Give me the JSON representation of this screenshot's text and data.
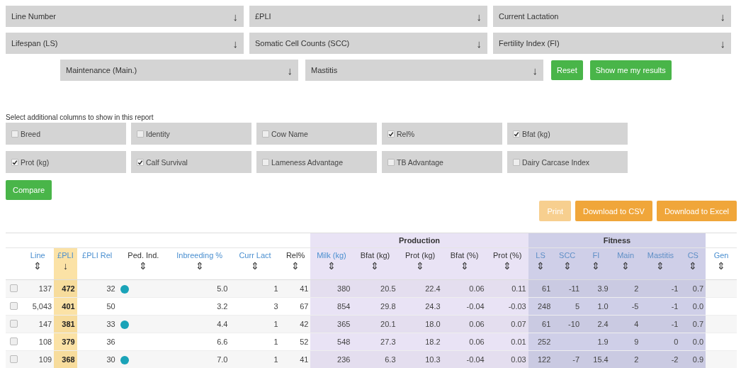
{
  "filters": [
    {
      "label": "Line Number",
      "arrow": "↓"
    },
    {
      "label": "£PLI",
      "arrow": "↓"
    },
    {
      "label": "Current Lactation",
      "arrow": "↓"
    },
    {
      "label": "Lifespan (LS)",
      "arrow": "↓"
    },
    {
      "label": "Somatic Cell Counts (SCC)",
      "arrow": "↓"
    },
    {
      "label": "Fertility Index (FI)",
      "arrow": "↓"
    },
    {
      "label": "Maintenance (Main.)",
      "arrow": "↓"
    },
    {
      "label": "Mastitis",
      "arrow": "↓"
    }
  ],
  "filter_buttons": [
    "Reset",
    "Show me my results"
  ],
  "columns_prompt": "Select additional columns to show in this report",
  "column_options": [
    {
      "label": "Breed",
      "checked": false
    },
    {
      "label": "Identity",
      "checked": false
    },
    {
      "label": "Cow Name",
      "checked": false
    },
    {
      "label": "Rel%",
      "checked": true
    },
    {
      "label": "Bfat (kg)",
      "checked": true
    },
    {
      "label": "Prot (kg)",
      "checked": true
    },
    {
      "label": "Calf Survival",
      "checked": true
    },
    {
      "label": "Lameness Advantage",
      "checked": false
    },
    {
      "label": "TB Advantage",
      "checked": false
    },
    {
      "label": "Dairy Carcase Index",
      "checked": false
    }
  ],
  "compare_button": "Compare",
  "export_buttons": [
    {
      "label": "Print",
      "disabled": true
    },
    {
      "label": "Download to CSV",
      "disabled": false
    },
    {
      "label": "Download to Excel",
      "disabled": false
    }
  ],
  "table": {
    "groups": [
      {
        "label": "Production",
        "kind": "production"
      },
      {
        "label": "Fitness",
        "kind": "fitness"
      }
    ],
    "columns": [
      {
        "label": "Line",
        "sort": "⇕",
        "link": true,
        "kind": "plain",
        "sorted": false
      },
      {
        "label": "£PLI",
        "sort": "↓",
        "link": true,
        "kind": "plain",
        "sorted": true
      },
      {
        "label": "£PLI Rel",
        "link": true,
        "kind": "plain",
        "sorted": false
      },
      {
        "label": "Ped. Ind.",
        "sort": "⇕",
        "link": false,
        "kind": "plain",
        "sorted": false
      },
      {
        "label": "Inbreeding %",
        "sort": "⇕",
        "link": true,
        "kind": "plain",
        "sorted": false
      },
      {
        "label": "Curr Lact",
        "sort": "⇕",
        "link": true,
        "kind": "plain",
        "sorted": false
      },
      {
        "label": "Rel%",
        "sort": "⇕",
        "link": false,
        "kind": "plain",
        "sorted": false
      },
      {
        "label": "Milk (kg)",
        "sort": "⇕",
        "link": true,
        "kind": "production",
        "sorted": false
      },
      {
        "label": "Bfat (kg)",
        "sort": "⇕",
        "link": false,
        "kind": "production",
        "sorted": false
      },
      {
        "label": "Prot (kg)",
        "sort": "⇕",
        "link": false,
        "kind": "production",
        "sorted": false
      },
      {
        "label": "Bfat (%)",
        "sort": "⇕",
        "link": false,
        "kind": "production",
        "sorted": false
      },
      {
        "label": "Prot (%)",
        "sort": "⇕",
        "link": false,
        "kind": "production",
        "sorted": false
      },
      {
        "label": "LS",
        "sort": "⇕",
        "link": true,
        "kind": "fitness",
        "sorted": false
      },
      {
        "label": "SCC",
        "sort": "⇕",
        "link": true,
        "kind": "fitness",
        "sorted": false
      },
      {
        "label": "FI",
        "sort": "⇕",
        "link": true,
        "kind": "fitness",
        "sorted": false
      },
      {
        "label": "Main",
        "sort": "⇕",
        "link": true,
        "kind": "fitness",
        "sorted": false
      },
      {
        "label": "Mastitis",
        "sort": "⇕",
        "link": true,
        "kind": "fitness",
        "sorted": false
      },
      {
        "label": "CS",
        "sort": "⇕",
        "link": true,
        "kind": "fitness",
        "sorted": false
      },
      {
        "label": "Gen",
        "sort": "⇕",
        "link": true,
        "kind": "plain",
        "sorted": false
      }
    ],
    "rows": [
      {
        "selected": false,
        "ped_badge": true,
        "cells": [
          "137",
          "472",
          "32",
          "",
          "5.0",
          "1",
          "41",
          "380",
          "20.5",
          "22.4",
          "0.06",
          "0.11",
          "61",
          "-11",
          "3.9",
          "2",
          "-1",
          "0.7",
          ""
        ]
      },
      {
        "selected": false,
        "ped_badge": false,
        "cells": [
          "5,043",
          "401",
          "50",
          "",
          "3.2",
          "3",
          "67",
          "854",
          "29.8",
          "24.3",
          "-0.04",
          "-0.03",
          "248",
          "5",
          "1.0",
          "-5",
          "-1",
          "0.0",
          ""
        ]
      },
      {
        "selected": false,
        "ped_badge": true,
        "cells": [
          "147",
          "381",
          "33",
          "",
          "4.4",
          "1",
          "42",
          "365",
          "20.1",
          "18.0",
          "0.06",
          "0.07",
          "61",
          "-10",
          "2.4",
          "4",
          "-1",
          "0.7",
          ""
        ]
      },
      {
        "selected": false,
        "ped_badge": false,
        "cells": [
          "108",
          "379",
          "36",
          "",
          "6.6",
          "1",
          "52",
          "548",
          "27.3",
          "18.2",
          "0.06",
          "0.01",
          "252",
          "",
          "1.9",
          "9",
          "0",
          "0.0",
          ""
        ]
      },
      {
        "selected": false,
        "ped_badge": true,
        "cells": [
          "109",
          "368",
          "30",
          "",
          "7.0",
          "1",
          "41",
          "236",
          "6.3",
          "10.3",
          "-0.04",
          "0.03",
          "122",
          "-7",
          "15.4",
          "2",
          "-2",
          "0.9",
          ""
        ]
      }
    ]
  }
}
